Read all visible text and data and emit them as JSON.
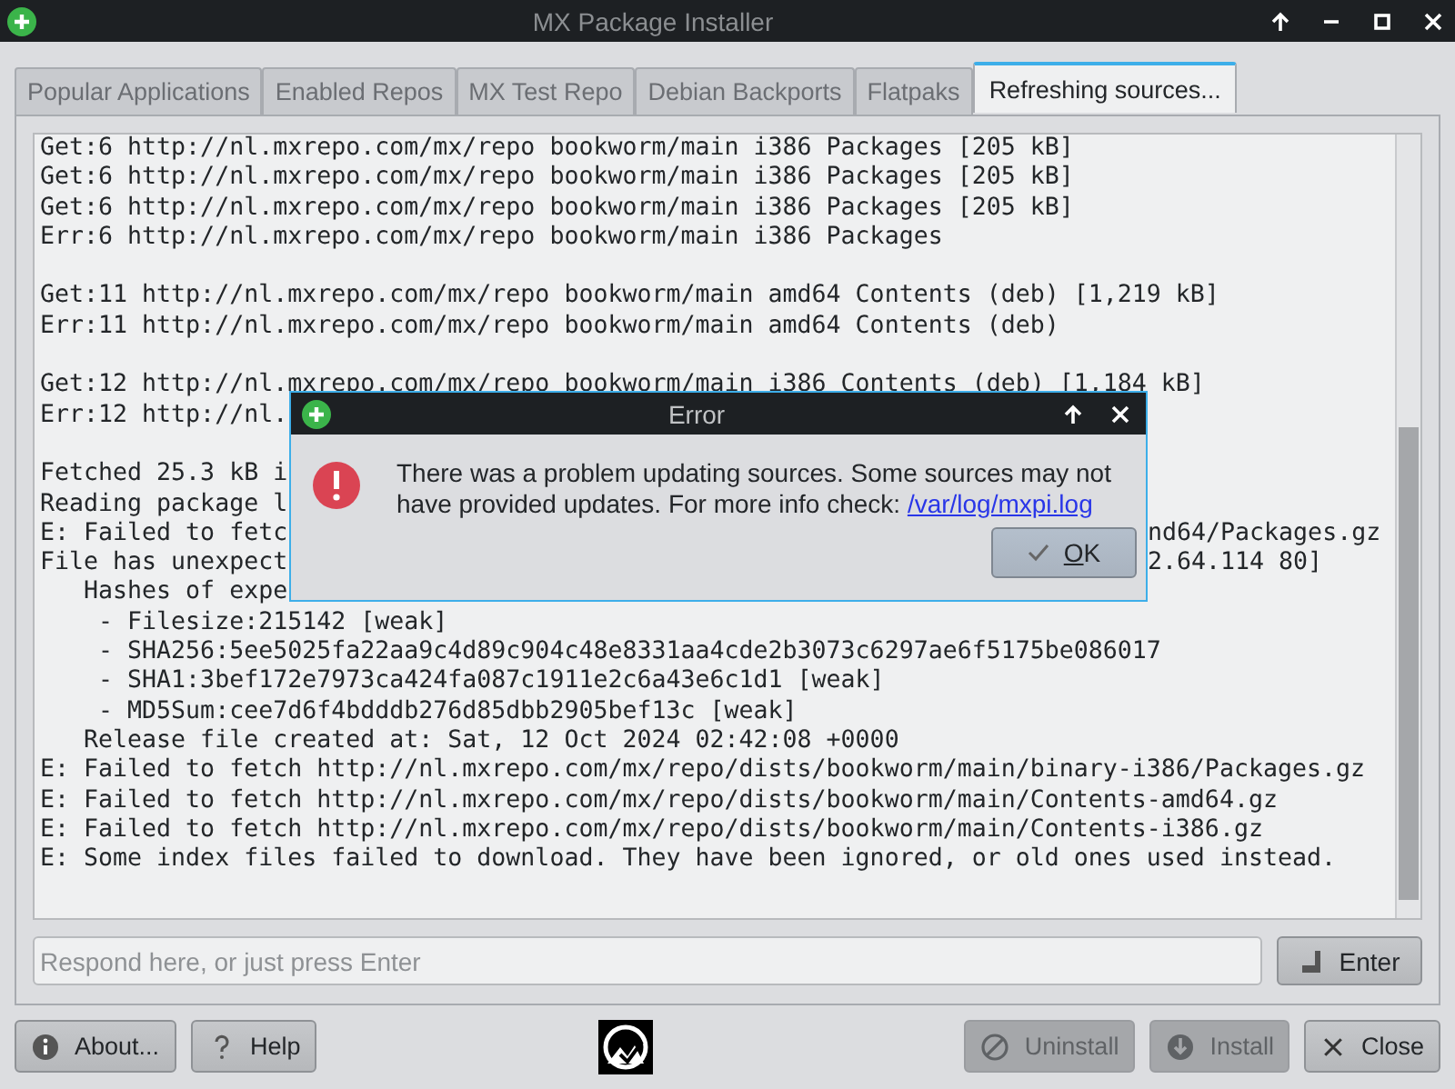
{
  "window": {
    "title": "MX Package Installer"
  },
  "tabs": [
    {
      "label": "Popular Applications",
      "selected": false
    },
    {
      "label": "Enabled Repos",
      "selected": false
    },
    {
      "label": "MX Test Repo",
      "selected": false
    },
    {
      "label": "Debian Backports",
      "selected": false
    },
    {
      "label": "Flatpaks",
      "selected": false
    },
    {
      "label": "Refreshing sources...",
      "selected": true
    }
  ],
  "log": {
    "lines": [
      {
        "kind": "text",
        "text": "Get:6 http://nl.mxrepo.com/mx/repo bookworm/main i386 Packages [205 kB]"
      },
      {
        "kind": "text",
        "text": "Get:6 http://nl.mxrepo.com/mx/repo bookworm/main i386 Packages [205 kB]"
      },
      {
        "kind": "text",
        "text": "Get:6 http://nl.mxrepo.com/mx/repo bookworm/main i386 Packages [205 kB]"
      },
      {
        "kind": "text",
        "text": "Err:6 http://nl.mxrepo.com/mx/repo bookworm/main i386 Packages"
      },
      {
        "kind": "blank"
      },
      {
        "kind": "text",
        "text": "Get:11 http://nl.mxrepo.com/mx/repo bookworm/main amd64 Contents (deb) [1,219 kB]"
      },
      {
        "kind": "text",
        "text": "Err:11 http://nl.mxrepo.com/mx/repo bookworm/main amd64 Contents (deb)"
      },
      {
        "kind": "blank"
      },
      {
        "kind": "text",
        "text": "Get:12 http://nl.mxrepo.com/mx/repo bookworm/main i386 Contents (deb) [1,184 kB]"
      },
      {
        "kind": "text",
        "text": "Err:12 http://nl."
      },
      {
        "kind": "blank"
      },
      {
        "kind": "text",
        "text": "Fetched 25.3 kB i"
      },
      {
        "kind": "text",
        "text": "Reading package l"
      },
      {
        "kind": "text",
        "text": "E: Failed to fetc",
        "tail": "nd64/Packages.gz"
      },
      {
        "kind": "text",
        "text": "File has unexpect",
        "tail": "2.64.114 80]"
      },
      {
        "kind": "text",
        "text": "   Hashes of expe"
      },
      {
        "kind": "text",
        "text": "    - Filesize:215142 [weak]"
      },
      {
        "kind": "text",
        "text": "    - SHA256:5ee5025fa22aa9c4d89c904c48e8331aa4cde2b3073c6297ae6f5175be086017"
      },
      {
        "kind": "text",
        "text": "    - SHA1:3bef172e7973ca424fa087c1911e2c6a43e6c1d1 [weak]"
      },
      {
        "kind": "text",
        "text": "    - MD5Sum:cee7d6f4bdddb276d85dbb2905bef13c [weak]"
      },
      {
        "kind": "text",
        "text": "   Release file created at: Sat, 12 Oct 2024 02:42:08 +0000"
      },
      {
        "kind": "text",
        "text": "E: Failed to fetch http://nl.mxrepo.com/mx/repo/dists/bookworm/main/binary-i386/Packages.gz"
      },
      {
        "kind": "text",
        "text": "E: Failed to fetch http://nl.mxrepo.com/mx/repo/dists/bookworm/main/Contents-amd64.gz"
      },
      {
        "kind": "text",
        "text": "E: Failed to fetch http://nl.mxrepo.com/mx/repo/dists/bookworm/main/Contents-i386.gz"
      },
      {
        "kind": "text",
        "text": "E: Some index files failed to download. They have been ignored, or old ones used instead."
      }
    ]
  },
  "input": {
    "placeholder": "Respond here, or just press Enter"
  },
  "enter_button": {
    "label": "Enter"
  },
  "buttons": [
    {
      "label": "About...",
      "disabled": false
    },
    {
      "label": "Help",
      "disabled": false
    },
    {
      "label": "Uninstall",
      "disabled": true
    },
    {
      "label": "Install",
      "disabled": true
    },
    {
      "label": "Close",
      "disabled": false
    }
  ],
  "dialog": {
    "title": "Error",
    "message": "There was a problem updating sources. Some sources may not have provided updates. For more info check:",
    "link": "/var/log/mxpi.log",
    "button": "OK"
  }
}
